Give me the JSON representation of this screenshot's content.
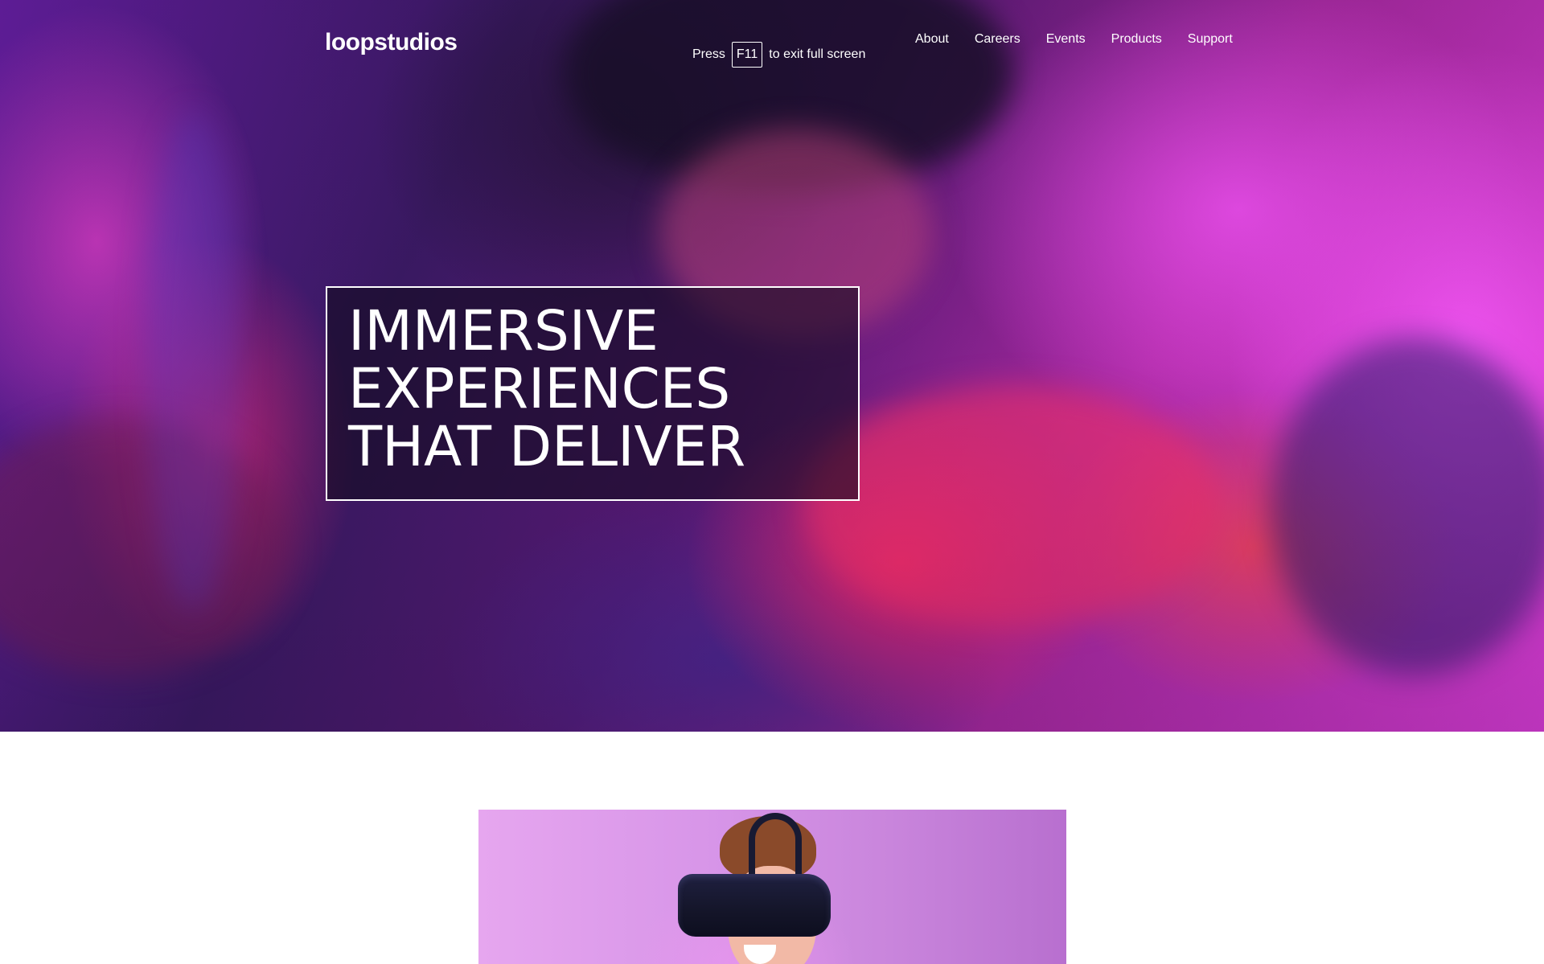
{
  "brand": {
    "logo_text": "loopstudios"
  },
  "nav": {
    "items": [
      {
        "label": "About"
      },
      {
        "label": "Careers"
      },
      {
        "label": "Events"
      },
      {
        "label": "Products"
      },
      {
        "label": "Support"
      }
    ]
  },
  "fullscreen_hint": {
    "prefix": "Press",
    "key": "F11",
    "suffix": "to exit full screen"
  },
  "hero": {
    "headline_lines": [
      "IMMERSIVE",
      "EXPERIENCES",
      "THAT DELIVER"
    ]
  },
  "colors": {
    "text_on_hero": "#ffffff",
    "page_background": "#ffffff",
    "hero_accent_magenta": "#e53fe0",
    "hero_accent_red": "#ff2870",
    "feature_image_lilac": "#d795e8"
  },
  "images": {
    "hero": "person-in-vr-headset-driving-simulator",
    "feature": "man-wearing-vr-headset"
  }
}
